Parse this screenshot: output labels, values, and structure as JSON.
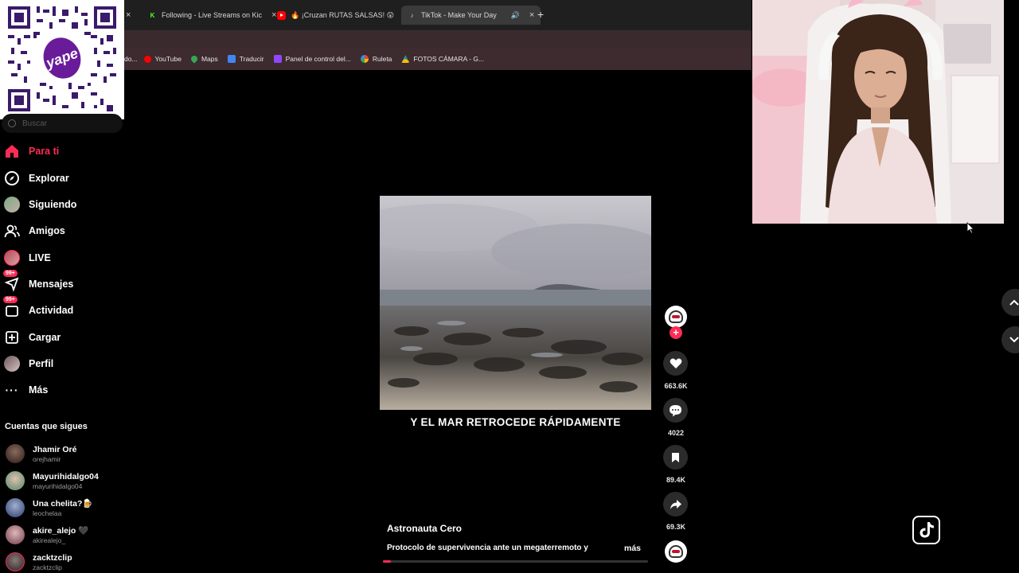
{
  "browser": {
    "tabs": [
      {
        "label": "Following - Live Streams on Kic",
        "favicon": "kick-icon",
        "color": "#53fc18"
      },
      {
        "label": "🔥 ¡Cruzan RUTAS SALSAS! 😲",
        "favicon": "youtube-icon",
        "color": "#ff0000"
      },
      {
        "label": "TikTok - Make Your Day",
        "favicon": "tiktok-icon",
        "color": "#ffffff",
        "active": true
      }
    ],
    "new_tab": "+",
    "bookmarks": [
      {
        "label": "YouTube",
        "icon": "youtube-icon",
        "color": "#ff0000"
      },
      {
        "label": "Maps",
        "icon": "maps-pin-icon",
        "color": "#34a853"
      },
      {
        "label": "Traducir",
        "icon": "translate-icon",
        "color": "#4285f4"
      },
      {
        "label": "Panel de control del...",
        "icon": "twitch-icon",
        "color": "#9146ff"
      },
      {
        "label": "Ruleta",
        "icon": "google-icon",
        "color": "#fbbc05"
      },
      {
        "label": "FOTOS CÁMARA - G...",
        "icon": "drive-icon",
        "color": "#0f9d58"
      }
    ],
    "truncated_prefix": "do..."
  },
  "overlay": {
    "qr_label": "yape"
  },
  "sidebar": {
    "search_placeholder": "Buscar",
    "items": [
      {
        "label": "Para ti",
        "icon": "home-icon",
        "active": true
      },
      {
        "label": "Explorar",
        "icon": "compass-icon"
      },
      {
        "label": "Siguiendo",
        "icon": "following-avatar-icon"
      },
      {
        "label": "Amigos",
        "icon": "friends-icon"
      },
      {
        "label": "LIVE",
        "icon": "live-avatar-icon"
      },
      {
        "label": "Mensajes",
        "icon": "messages-icon",
        "badge": "99+"
      },
      {
        "label": "Actividad",
        "icon": "activity-icon",
        "badge": "99+"
      },
      {
        "label": "Cargar",
        "icon": "upload-icon"
      },
      {
        "label": "Perfil",
        "icon": "profile-avatar-icon"
      },
      {
        "label": "Más",
        "icon": "more-icon"
      }
    ],
    "following_header": "Cuentas que sigues",
    "following": [
      {
        "name": "Jhamir Oré",
        "user": "orejhamir",
        "color": "#6b4a3a"
      },
      {
        "name": "Mayurihidalgo04",
        "user": "mayurihidalgo04",
        "color": "#7aa88a"
      },
      {
        "name": "Una chelita?🍺",
        "user": "leochelaa",
        "color": "#3a5a8a"
      },
      {
        "name": "akire_alejo 🖤",
        "user": "akirealejo_",
        "color": "#9a6a7a"
      },
      {
        "name": "zacktzclip",
        "user": "zacktzclip",
        "color": "#5a4a4a"
      }
    ]
  },
  "video": {
    "subtitle": "Y EL MAR RETROCEDE RÁPIDAMENTE",
    "author": "Astronauta Cero",
    "description": "Protocolo de supervivencia ante un megaterremoto y",
    "more": "más",
    "progress": 0.03
  },
  "actions": {
    "likes": "663.6K",
    "comments": "4022",
    "saves": "89.4K",
    "shares": "69.3K"
  },
  "colors": {
    "accent": "#fe2c55",
    "background": "#000000"
  }
}
